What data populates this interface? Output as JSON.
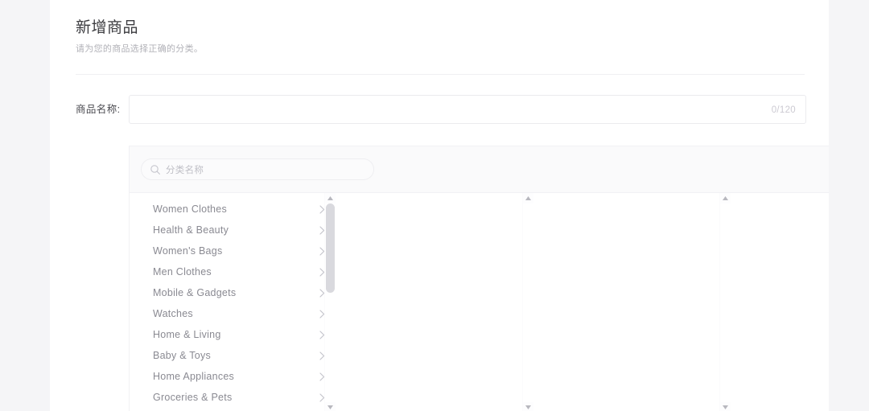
{
  "page": {
    "background_color": "#f5f5f7",
    "card_background": "#ffffff"
  },
  "header": {
    "title": "新增商品",
    "subtitle": "请为您的商品选择正确的分类。"
  },
  "product_name_field": {
    "label": "商品名称:",
    "value": "",
    "placeholder": "",
    "char_counter": "0/120",
    "max_length": 120
  },
  "category_selector": {
    "search": {
      "placeholder": "分类名称",
      "value": "",
      "icon": "search-icon"
    },
    "columns": [
      {
        "name": "level-1",
        "items": [
          {
            "label": "Women Clothes",
            "chevron": "chevron-right-icon"
          },
          {
            "label": "Health & Beauty",
            "chevron": "chevron-right-icon"
          },
          {
            "label": "Women's Bags",
            "chevron": "chevron-right-icon"
          },
          {
            "label": "Men Clothes",
            "chevron": "chevron-right-icon"
          },
          {
            "label": "Mobile & Gadgets",
            "chevron": "chevron-right-icon"
          },
          {
            "label": "Watches",
            "chevron": "chevron-right-icon"
          },
          {
            "label": "Home & Living",
            "chevron": "chevron-right-icon"
          },
          {
            "label": "Baby & Toys",
            "chevron": "chevron-right-icon"
          },
          {
            "label": "Home Appliances",
            "chevron": "chevron-right-icon"
          },
          {
            "label": "Groceries & Pets",
            "chevron": "chevron-right-icon"
          }
        ],
        "scrollbar": {
          "thumb_top_pct": 0,
          "thumb_height_pct": 45
        }
      },
      {
        "name": "level-2",
        "items": [],
        "scrollbar": {
          "thumb_top_pct": 0,
          "thumb_height_pct": 0
        }
      },
      {
        "name": "level-3",
        "items": [],
        "scrollbar": {
          "thumb_top_pct": 0,
          "thumb_height_pct": 0
        }
      }
    ]
  },
  "colors": {
    "text_primary": "#3b3b3f",
    "text_secondary": "#8a8a92",
    "text_muted": "#b2b2b8",
    "border": "#ebebee",
    "panel_background": "#fafafb",
    "scrollbar_thumb": "#d9d9de"
  }
}
